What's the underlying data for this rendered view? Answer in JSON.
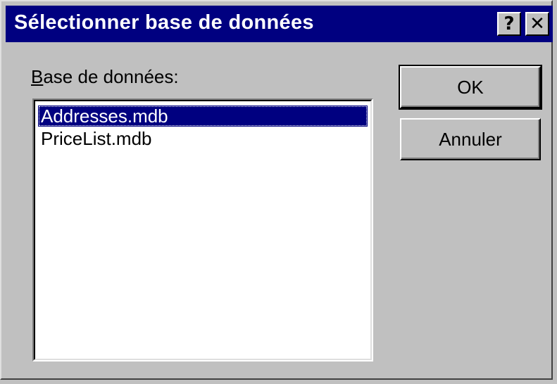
{
  "window": {
    "title": "Sélectionner base de données",
    "help_icon": "?",
    "close_icon": "✕"
  },
  "database_label": {
    "mnemonic": "B",
    "rest": "ase de données:"
  },
  "database_list": {
    "items": [
      {
        "label": "Addresses.mdb",
        "selected": true
      },
      {
        "label": "PriceList.mdb",
        "selected": false
      }
    ]
  },
  "buttons": {
    "ok_label": "OK",
    "cancel_label": "Annuler"
  },
  "colors": {
    "titlebar": "#000080",
    "face": "#c0c0c0",
    "selection": "#000080"
  }
}
